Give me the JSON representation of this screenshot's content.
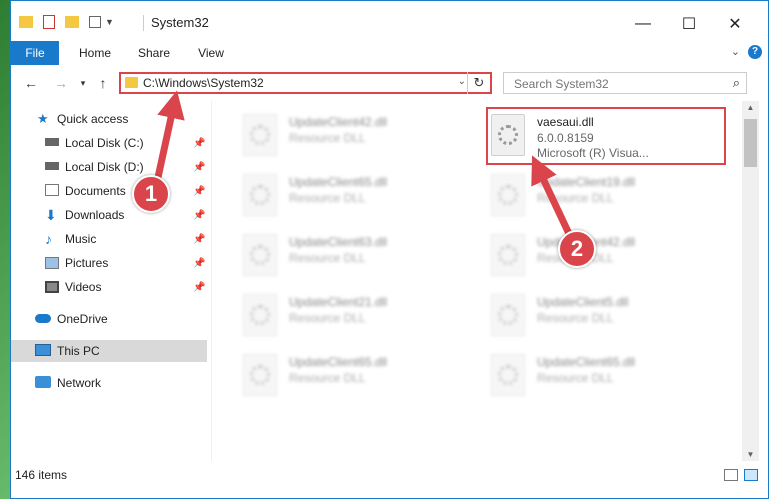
{
  "window": {
    "title": "System32",
    "controls": {
      "minimize": "—",
      "maximize": "☐",
      "close": "✕"
    }
  },
  "ribbon": {
    "tabs": [
      "File",
      "Home",
      "Share",
      "View"
    ],
    "help": "?"
  },
  "nav": {
    "back": "←",
    "forward": "→",
    "recent": "▾",
    "up": "↑",
    "address": "C:\\Windows\\System32",
    "refresh": "↻",
    "search_placeholder": "Search System32"
  },
  "sidebar": {
    "items": [
      {
        "label": "Quick access",
        "icon": "star-icon",
        "pinned": false
      },
      {
        "label": "Local Disk (C:)",
        "icon": "drive-icon",
        "pinned": true
      },
      {
        "label": "Local Disk (D:)",
        "icon": "drive-icon",
        "pinned": true
      },
      {
        "label": "Documents",
        "icon": "documents-icon",
        "pinned": true
      },
      {
        "label": "Downloads",
        "icon": "download-icon",
        "pinned": true
      },
      {
        "label": "Music",
        "icon": "music-icon",
        "pinned": true
      },
      {
        "label": "Pictures",
        "icon": "pictures-icon",
        "pinned": true
      },
      {
        "label": "Videos",
        "icon": "videos-icon",
        "pinned": true
      },
      {
        "label": "OneDrive",
        "icon": "cloud-icon",
        "pinned": false
      },
      {
        "label": "This PC",
        "icon": "computer-icon",
        "pinned": false,
        "selected": true
      },
      {
        "label": "Network",
        "icon": "network-icon",
        "pinned": false
      }
    ]
  },
  "files": {
    "left": [
      {
        "name": "UpdateClient42.dll",
        "type": "Resource DLL"
      },
      {
        "name": "UpdateClient65.dll",
        "type": "Resource DLL"
      },
      {
        "name": "UpdateClient63.dll",
        "type": "Resource DLL"
      },
      {
        "name": "UpdateClient21.dll",
        "type": "Resource DLL"
      },
      {
        "name": "UpdateClient65.dll",
        "type": "Resource DLL"
      }
    ],
    "right": [
      {
        "name": "vaesaui.dll",
        "version": "6.0.0.8159",
        "company": "Microsoft (R) Visua..."
      },
      {
        "name": "UpdateClient19.dll",
        "type": "Resource DLL"
      },
      {
        "name": "UpdateClient42.dll",
        "type": "Resource DLL"
      },
      {
        "name": "UpdateClient5.dll",
        "type": "Resource DLL"
      },
      {
        "name": "UpdateClient65.dll",
        "type": "Resource DLL"
      }
    ]
  },
  "status": {
    "item_count": "146 items"
  },
  "annotations": {
    "step1": "1",
    "step2": "2"
  },
  "colors": {
    "accent": "#1979ca",
    "highlight": "#d9454a"
  }
}
